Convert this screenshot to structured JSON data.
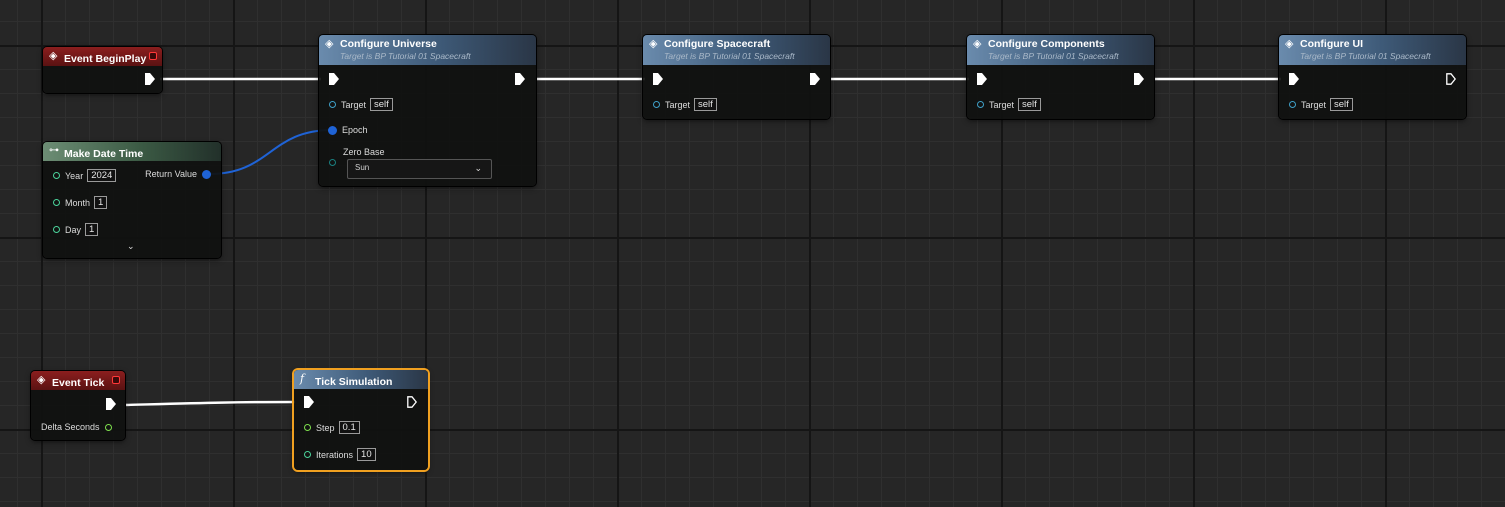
{
  "nodes": {
    "begin_play": {
      "title": "Event BeginPlay",
      "icon": "event-diamond-icon"
    },
    "configure_universe": {
      "title": "Configure Universe",
      "subtitle": "Target is BP Tutorial 01 Spacecraft",
      "pins": {
        "target_label": "Target",
        "target_value": "self",
        "epoch_label": "Epoch",
        "zero_base_label": "Zero Base",
        "zero_base_value": "Sun"
      }
    },
    "configure_spacecraft": {
      "title": "Configure Spacecraft",
      "subtitle": "Target is BP Tutorial 01 Spacecraft",
      "pins": {
        "target_label": "Target",
        "target_value": "self"
      }
    },
    "configure_components": {
      "title": "Configure Components",
      "subtitle": "Target is BP Tutorial 01 Spacecraft",
      "pins": {
        "target_label": "Target",
        "target_value": "self"
      }
    },
    "configure_ui": {
      "title": "Configure UI",
      "subtitle": "Target is BP Tutorial 01 Spacecraft",
      "pins": {
        "target_label": "Target",
        "target_value": "self"
      }
    },
    "make_date_time": {
      "title": "Make Date Time",
      "pins": {
        "year_label": "Year",
        "year_value": "2024",
        "month_label": "Month",
        "month_value": "1",
        "day_label": "Day",
        "day_value": "1",
        "return_label": "Return Value"
      }
    },
    "event_tick": {
      "title": "Event Tick",
      "pins": {
        "delta_label": "Delta Seconds"
      }
    },
    "tick_simulation": {
      "title": "Tick Simulation",
      "icon": "function-icon",
      "pins": {
        "step_label": "Step",
        "step_value": "0.1",
        "iterations_label": "Iterations",
        "iterations_value": "10"
      }
    }
  },
  "colors": {
    "background": "#262626",
    "exec_wire": "#ffffff",
    "datetime_wire": "#1f63d6",
    "event_header": "#8b1e1e",
    "call_header": "#3e5a78",
    "pure_header": "#3b5a44",
    "selection": "#f0a020"
  }
}
